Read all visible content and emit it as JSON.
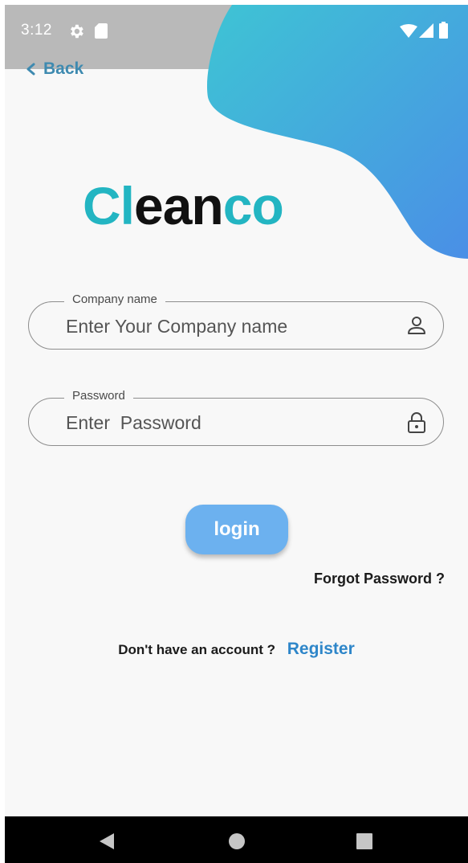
{
  "status_bar": {
    "time": "3:12",
    "left_icons": [
      "gear-icon",
      "sd-card-icon"
    ],
    "right_icons": [
      "wifi-icon",
      "cellular-signal-icon",
      "battery-icon"
    ]
  },
  "header": {
    "back_label": "Back"
  },
  "logo": {
    "part1": "Cl",
    "part2": "ean",
    "part3": "co",
    "colors": {
      "teal": "#23b5c2",
      "dark": "#111111"
    }
  },
  "form": {
    "company": {
      "label": "Company name",
      "placeholder": "Enter Your Company name",
      "value": "",
      "icon": "person-icon"
    },
    "password": {
      "label": "Password",
      "placeholder": "Enter  Password",
      "value": "",
      "icon": "lock-icon"
    },
    "login_label": "login",
    "forgot_label": "Forgot Password ?"
  },
  "register": {
    "prompt": "Don't have an account ?",
    "link_label": "Register"
  },
  "nav": {
    "buttons": [
      "back-triangle-icon",
      "home-circle-icon",
      "recents-square-icon"
    ]
  },
  "colors": {
    "accent_blue": "#6cb1ef",
    "link_blue": "#2e86c9",
    "gradient_start": "#3ec4d4",
    "gradient_end": "#4a8fe6"
  }
}
